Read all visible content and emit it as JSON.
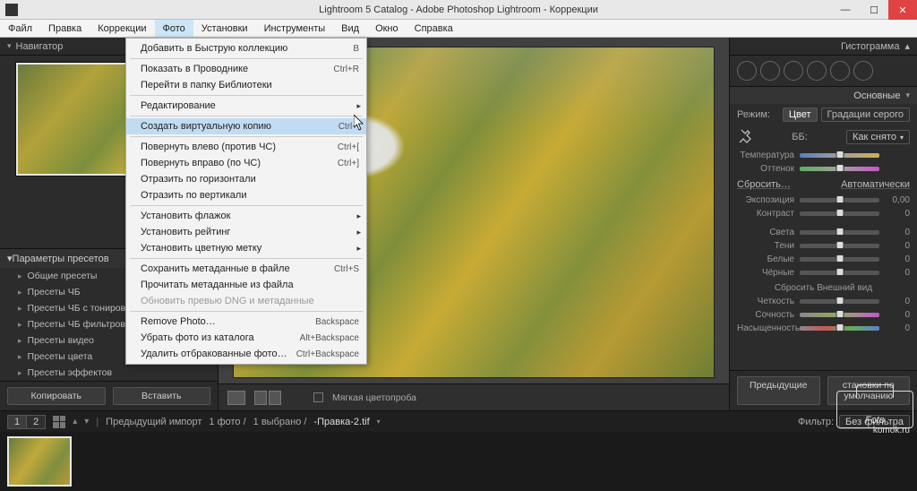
{
  "titlebar": {
    "title": "Lightroom 5 Catalog - Adobe Photoshop Lightroom - Коррекции"
  },
  "menubar": {
    "items": [
      "Файл",
      "Правка",
      "Коррекции",
      "Фото",
      "Установки",
      "Инструменты",
      "Вид",
      "Окно",
      "Справка"
    ],
    "open_index": 3
  },
  "dropdown": {
    "rows": [
      {
        "label": "Добавить в Быструю коллекцию",
        "sc": "B"
      },
      {
        "sep": true
      },
      {
        "label": "Показать в Проводнике",
        "sc": "Ctrl+R"
      },
      {
        "label": "Перейти в папку Библиотеки"
      },
      {
        "sep": true
      },
      {
        "label": "Редактирование",
        "sub": true
      },
      {
        "sep": true
      },
      {
        "label": "Создать виртуальную копию",
        "sc": "Ctrl+'",
        "hl": true
      },
      {
        "sep": true
      },
      {
        "label": "Повернуть влево (против ЧС)",
        "sc": "Ctrl+["
      },
      {
        "label": "Повернуть вправо (по ЧС)",
        "sc": "Ctrl+]"
      },
      {
        "label": "Отразить по горизонтали"
      },
      {
        "label": "Отразить по вертикали"
      },
      {
        "sep": true
      },
      {
        "label": "Установить флажок",
        "sub": true
      },
      {
        "label": "Установить рейтинг",
        "sub": true
      },
      {
        "label": "Установить цветную метку",
        "sub": true
      },
      {
        "sep": true
      },
      {
        "label": "Сохранить метаданные в файле",
        "sc": "Ctrl+S"
      },
      {
        "label": "Прочитать метаданные из файла"
      },
      {
        "label": "Обновить превью DNG и метаданные",
        "disabled": true
      },
      {
        "sep": true
      },
      {
        "label": "Remove Photo…",
        "sc": "Backspace"
      },
      {
        "label": "Убрать фото из каталога",
        "sc": "Alt+Backspace"
      },
      {
        "label": "Удалить отбракованные фото…",
        "sc": "Ctrl+Backspace"
      }
    ]
  },
  "left": {
    "navigator_title": "Навигатор",
    "presets_title": "Параметры пресетов",
    "presets": [
      "Общие пресеты",
      "Пресеты ЧБ",
      "Пресеты ЧБ с тониров",
      "Пресеты ЧБ фильтров",
      "Пресеты видео",
      "Пресеты цвета",
      "Пресеты эффектов"
    ],
    "copy_btn": "Копировать",
    "paste_btn": "Вставить"
  },
  "center": {
    "softproof_label": "Мягкая цветопроба"
  },
  "right": {
    "hist_title": "Гистограмма",
    "basic_title": "Основные",
    "mode_label": "Режим:",
    "mode_color": "Цвет",
    "mode_gray": "Градации серого",
    "wb_label": "ББ:",
    "wb_value": "Как снято",
    "sliders_top": [
      {
        "name": "Температура",
        "val": ""
      },
      {
        "name": "Оттенок",
        "val": ""
      }
    ],
    "reset_link": "Сбросить…",
    "auto_link": "Автоматически",
    "tone_sliders": [
      {
        "name": "Экспозиция",
        "val": "0,00"
      },
      {
        "name": "Контраст",
        "val": "0"
      }
    ],
    "tone_sliders2": [
      {
        "name": "Света",
        "val": "0"
      },
      {
        "name": "Тени",
        "val": "0"
      },
      {
        "name": "Белые",
        "val": "0"
      },
      {
        "name": "Чёрные",
        "val": "0"
      }
    ],
    "presence_title": "Сбросить Внешний вид",
    "presence_sliders": [
      {
        "name": "Четкость",
        "val": "0"
      },
      {
        "name": "Сочность",
        "val": "0"
      },
      {
        "name": "Насыщенность",
        "val": "0"
      }
    ],
    "prev_btn": "Предыдущие",
    "reset_btn": "становки по умолчанию"
  },
  "status": {
    "seg1": "1",
    "seg2": "2",
    "breadcrumb_prefix": "Предыдущий импорт",
    "breadcrumb_count": "1 фото /",
    "breadcrumb_sel": "1 выбрано /",
    "breadcrumb_file": "-Правка-2.tif",
    "filter_label": "Фильтр:",
    "filter_value": "Без фильтра"
  },
  "watermark": "komok.ru"
}
